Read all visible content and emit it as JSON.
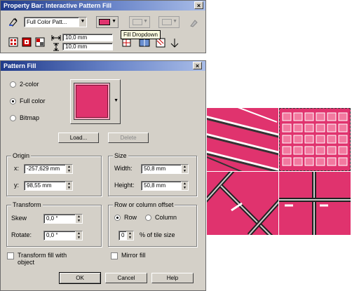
{
  "propbar": {
    "title": "Property Bar: Interactive Pattern Fill",
    "close": "×",
    "fill_type": "Full Color Patt...",
    "width_value": "10,0 mm",
    "height_value": "10,0 mm",
    "tooltip": "Fill Dropdown",
    "fill_color": "#e0336e"
  },
  "dialog": {
    "title": "Pattern Fill",
    "close": "×",
    "radios": {
      "two_color": "2-color",
      "full_color": "Full color",
      "bitmap": "Bitmap"
    },
    "load_label": "Load...",
    "delete_label": "Delete",
    "origin": {
      "label": "Origin",
      "x_label": "x:",
      "x_value": "-257,629 mm",
      "y_label": "y:",
      "y_value": "98,55 mm"
    },
    "size": {
      "label": "Size",
      "width_label": "Width:",
      "width_value": "50,8 mm",
      "height_label": "Height:",
      "height_value": "50,8 mm"
    },
    "transform": {
      "label": "Transform",
      "skew_label": "Skew",
      "skew_value": "0,0 °",
      "rotate_label": "Rotate:",
      "rotate_value": "0,0 °"
    },
    "offset": {
      "label": "Row or column offset",
      "row_label": "Row",
      "column_label": "Column",
      "percent_value": "0",
      "percent_label": "% of tile size"
    },
    "transform_fill_label": "Transform fill with object",
    "mirror_fill_label": "Mirror fill",
    "ok_label": "OK",
    "cancel_label": "Cancel",
    "help_label": "Help"
  },
  "colors": {
    "pink": "#e0336e",
    "dialog_bg": "#d4d0c8",
    "title_blue": "#1f3a8a"
  }
}
